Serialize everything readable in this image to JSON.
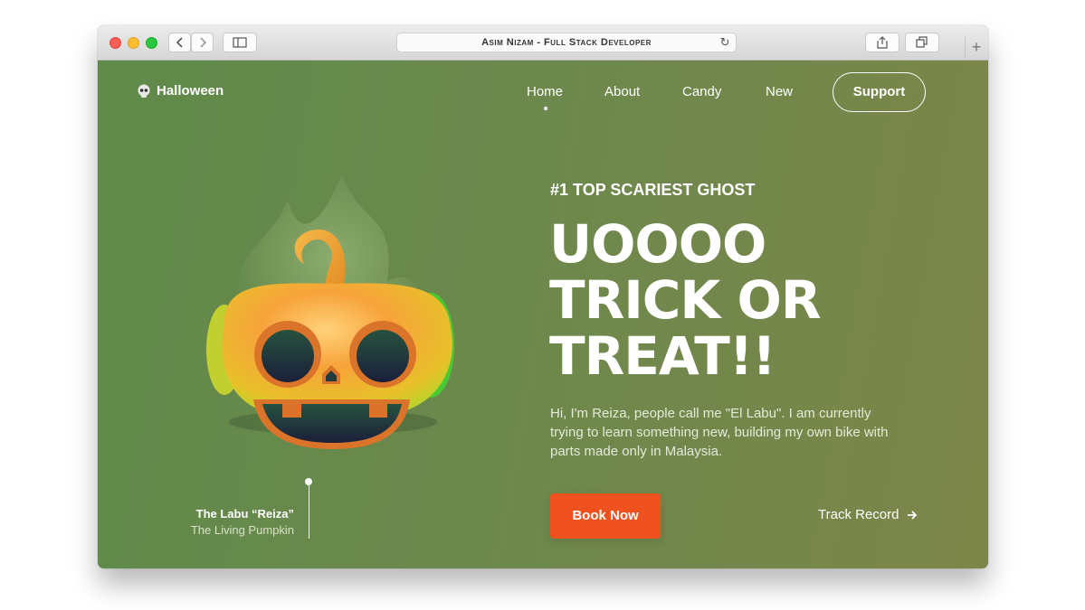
{
  "browser": {
    "address_title": "Asim Nizam - Full Stack Developer",
    "icons": [
      "back-icon",
      "forward-icon",
      "sidebar-icon",
      "reload-icon",
      "share-icon",
      "tabs-icon",
      "new-tab-icon"
    ]
  },
  "header": {
    "brand": "Halloween",
    "nav": [
      "Home",
      "About",
      "Candy",
      "New"
    ],
    "active_nav": "Home",
    "support": "Support"
  },
  "hero": {
    "subtitle": "#1 TOP SCARIEST GHOST",
    "headline_lines": [
      "UOOOO",
      "TRICK OR",
      "TREAT!!"
    ],
    "description": "Hi, I'm Reiza, people call me \"El Labu\". I am currently trying to learn something new, building my own bike with parts made only in Malaysia.",
    "book_button": "Book Now",
    "track_link": "Track Record"
  },
  "caption": {
    "name": "The Labu “Reiza”",
    "role": "The Living Pumpkin"
  },
  "colors": {
    "background_left": "#5f8a4a",
    "background_right": "#7d8649",
    "accent": "#f0521f",
    "text": "#ffffff"
  }
}
